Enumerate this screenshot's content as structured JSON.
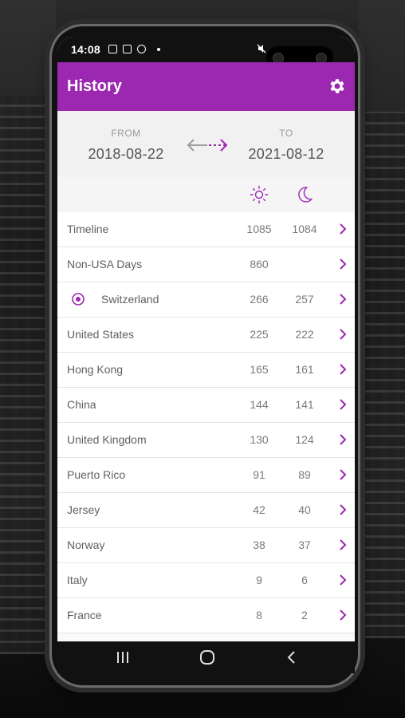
{
  "status_bar": {
    "time": "14:08"
  },
  "app_bar": {
    "title": "History",
    "settings_icon": "gear-icon"
  },
  "range": {
    "from_label": "FROM",
    "from_date": "2018-08-22",
    "to_label": "TO",
    "to_date": "2021-08-12"
  },
  "columns": {
    "day_icon": "sun-icon",
    "night_icon": "moon-icon"
  },
  "rows": [
    {
      "name": "Timeline",
      "day": "1085",
      "night": "1084"
    },
    {
      "name": "Non-USA Days",
      "day": "860",
      "night": ""
    },
    {
      "name": "Switzerland",
      "day": "266",
      "night": "257",
      "current": true
    },
    {
      "name": "United States",
      "day": "225",
      "night": "222"
    },
    {
      "name": "Hong Kong",
      "day": "165",
      "night": "161"
    },
    {
      "name": "China",
      "day": "144",
      "night": "141"
    },
    {
      "name": "United Kingdom",
      "day": "130",
      "night": "124"
    },
    {
      "name": "Puerto Rico",
      "day": "91",
      "night": "89"
    },
    {
      "name": "Jersey",
      "day": "42",
      "night": "40"
    },
    {
      "name": "Norway",
      "day": "38",
      "night": "37"
    },
    {
      "name": "Italy",
      "day": "9",
      "night": "6"
    },
    {
      "name": "France",
      "day": "8",
      "night": "2"
    }
  ],
  "colors": {
    "accent": "#9c27b0",
    "text": "#5f5f5f"
  }
}
